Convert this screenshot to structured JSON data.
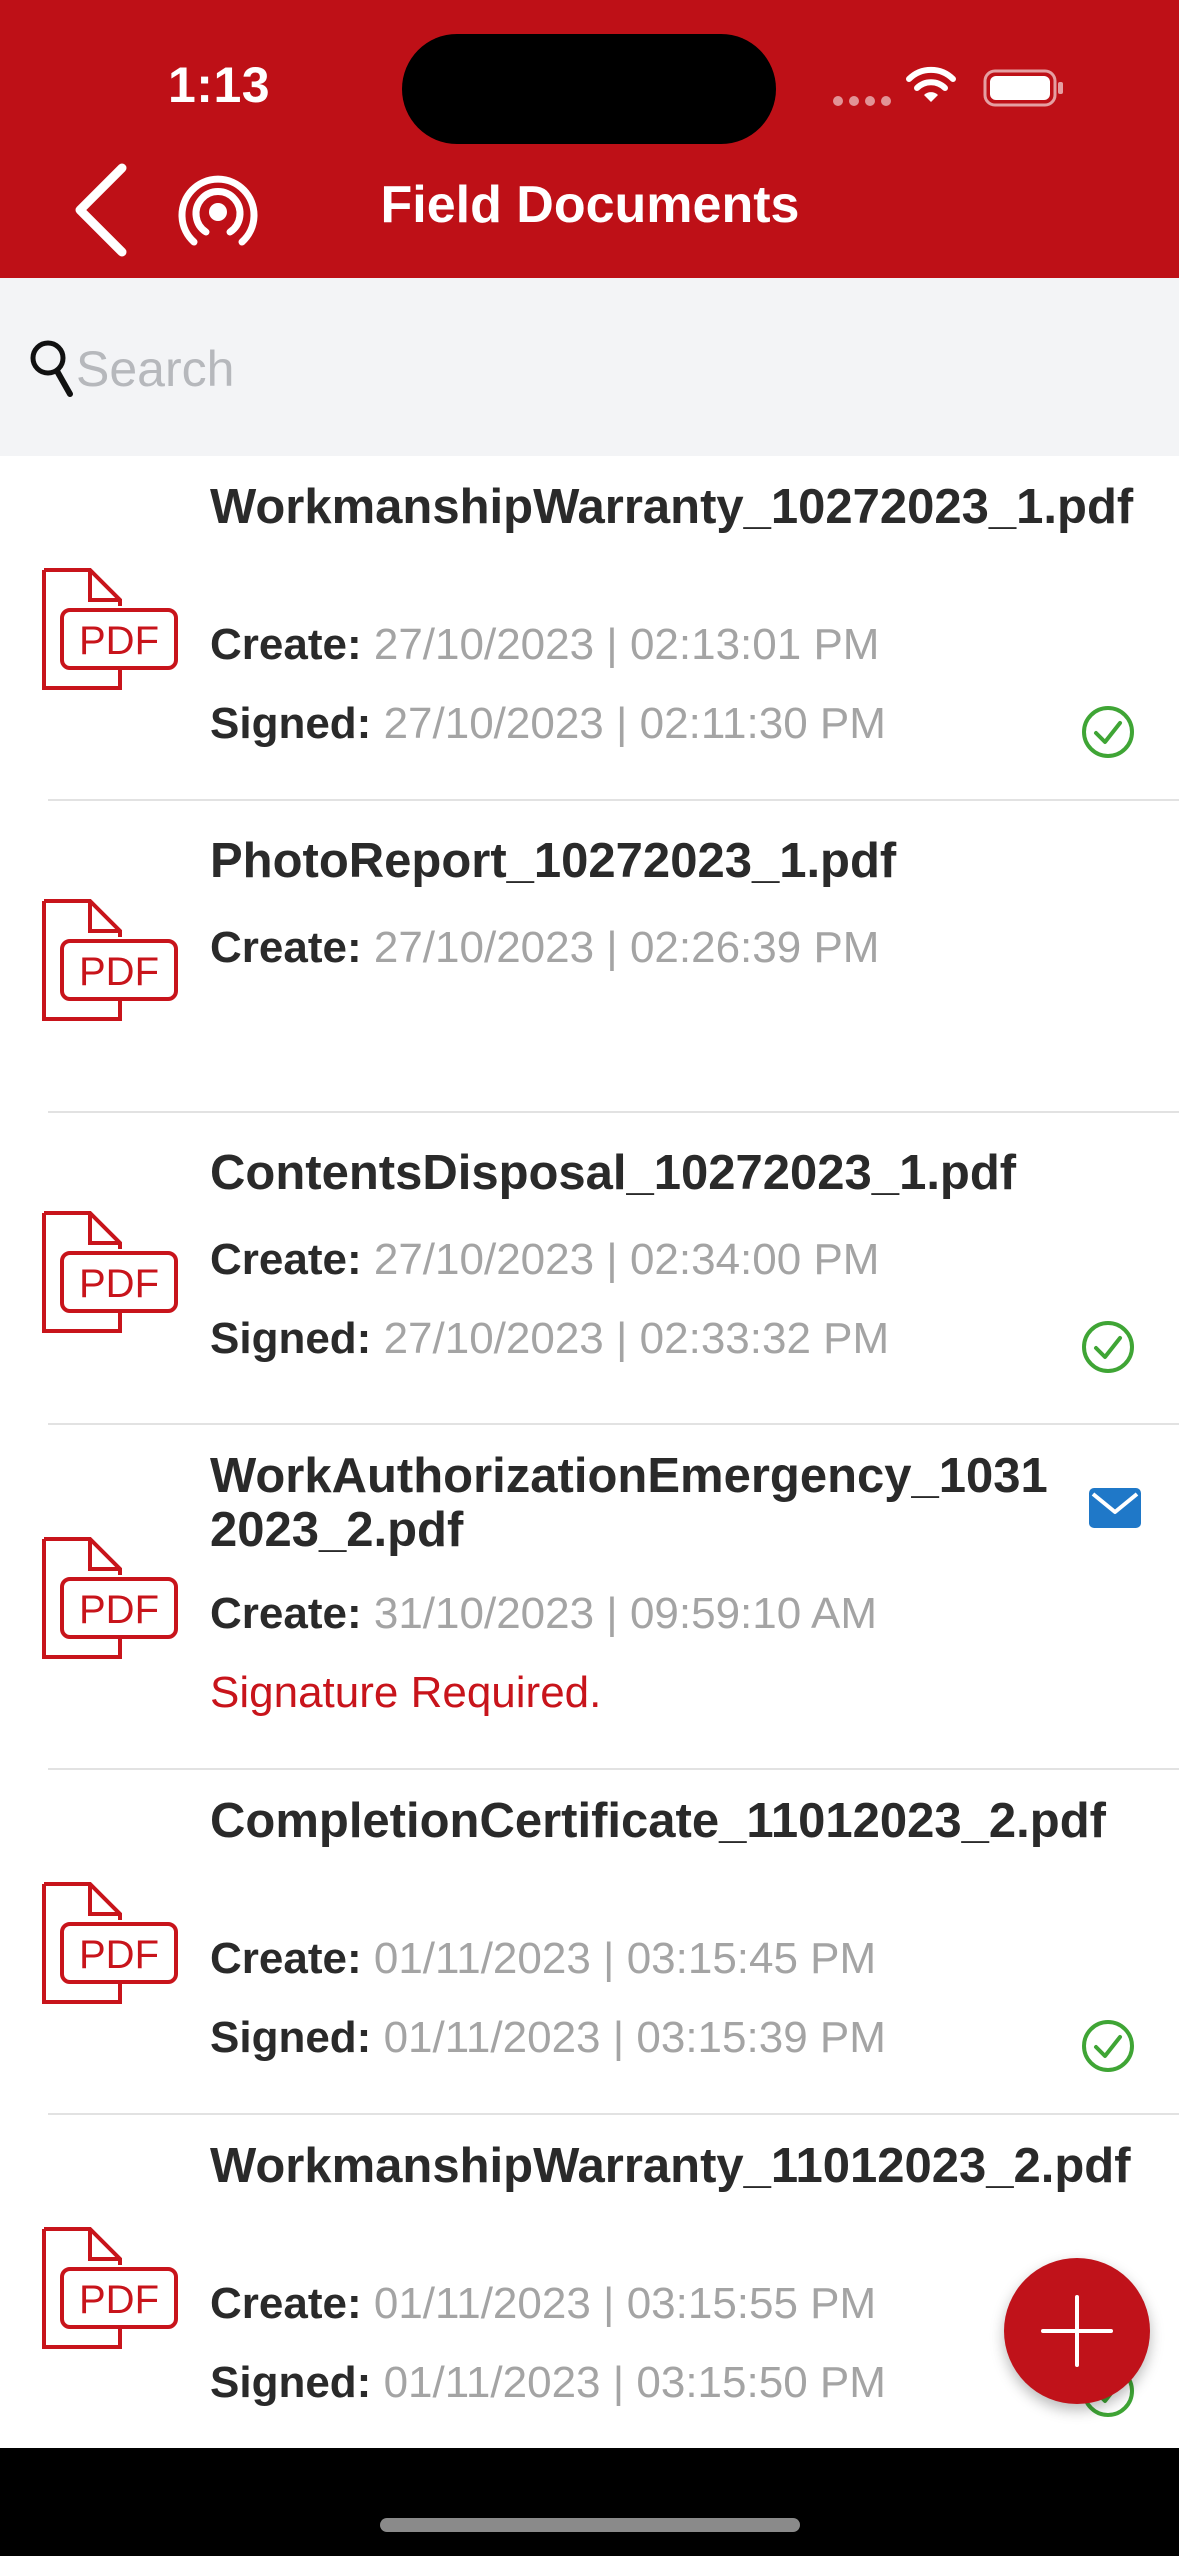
{
  "status_bar": {
    "time": "1:13"
  },
  "header": {
    "title": "Field Documents"
  },
  "search": {
    "placeholder": "Search",
    "value": ""
  },
  "labels": {
    "create": "Create:",
    "signed": "Signed:"
  },
  "colors": {
    "brand": "#BE1017",
    "signed_check": "#3FA535",
    "mail": "#1F78C8",
    "warning": "#C8141B"
  },
  "documents": [
    {
      "name": "WorkmanshipWarranty_10272023_1.pdf",
      "created": "27/10/2023 | 02:13:01 PM",
      "signed": "27/10/2023 | 02:11:30 PM",
      "status_icon": "check-circle-icon"
    },
    {
      "name": "PhotoReport_10272023_1.pdf",
      "created": "27/10/2023 | 02:26:39 PM"
    },
    {
      "name": "ContentsDisposal_10272023_1.pdf",
      "created": "27/10/2023 | 02:34:00 PM",
      "signed": "27/10/2023 | 02:33:32 PM",
      "status_icon": "check-circle-icon"
    },
    {
      "name": "WorkAuthorizationEmergency_10312023_2.pdf",
      "created": "31/10/2023 | 09:59:10 AM",
      "warning": "Signature Required.",
      "status_icon": "mail-icon"
    },
    {
      "name": "CompletionCertificate_11012023_2.pdf",
      "created": "01/11/2023 | 03:15:45 PM",
      "signed": "01/11/2023 | 03:15:39 PM",
      "status_icon": "check-circle-icon"
    },
    {
      "name": "WorkmanshipWarranty_11012023_2.pdf",
      "created": "01/11/2023 | 03:15:55 PM",
      "signed": "01/11/2023 | 03:15:50 PM",
      "status_icon": "check-circle-icon"
    }
  ]
}
